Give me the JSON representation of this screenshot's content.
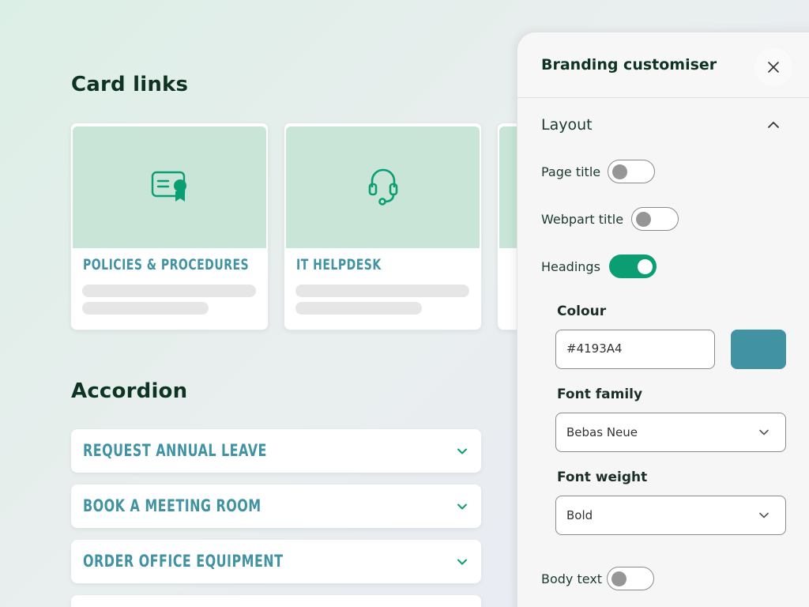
{
  "card_links": {
    "title": "Card links",
    "cards": [
      {
        "label": "Policies & Procedures",
        "icon": "certificate-icon"
      },
      {
        "label": "IT Helpdesk",
        "icon": "headset-icon"
      }
    ]
  },
  "accordion": {
    "title": "Accordion",
    "items": [
      {
        "label": "Request annual leave"
      },
      {
        "label": "Book a meeting room"
      },
      {
        "label": "Order office equipment"
      }
    ]
  },
  "panel": {
    "title": "Branding customiser",
    "section": "Layout",
    "toggles": {
      "page_title": {
        "label": "Page title",
        "on": false
      },
      "webpart_title": {
        "label": "Webpart title",
        "on": false
      },
      "headings": {
        "label": "Headings",
        "on": true
      },
      "body_text": {
        "label": "Body text",
        "on": false
      }
    },
    "colour": {
      "label": "Colour",
      "value": "#4193A4",
      "swatch": "#4193a4"
    },
    "font_family": {
      "label": "Font family",
      "value": "Bebas Neue"
    },
    "font_weight": {
      "label": "Font weight",
      "value": "Bold"
    }
  },
  "colors": {
    "accent": "#4193a4",
    "toggle_on": "#0b9e73",
    "card_bg": "#c8e5d7",
    "icon": "#0b9e73"
  }
}
